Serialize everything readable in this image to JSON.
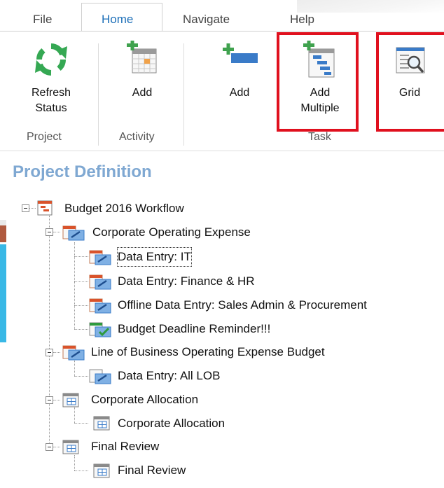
{
  "tabs": [
    {
      "label": "File",
      "active": false
    },
    {
      "label": "Home",
      "active": true
    },
    {
      "label": "Navigate",
      "active": false
    },
    {
      "label": "Help",
      "active": false
    }
  ],
  "ribbon": {
    "refresh_label_1": "Refresh",
    "refresh_label_2": "Status",
    "activity_add_label": "Add",
    "task_add_label": "Add",
    "add_multiple_1": "Add",
    "add_multiple_2": "Multiple",
    "grid_label": "Grid",
    "groups": {
      "project": "Project",
      "activity": "Activity",
      "task": "Task"
    }
  },
  "panel": {
    "title": "Project Definition"
  },
  "tree": {
    "root": "Budget 2016 Workflow",
    "corp_opex": "Corporate Operating Expense",
    "data_entry_it": "Data Entry: IT",
    "data_entry_finance": "Data Entry:  Finance & HR",
    "offline_entry": "Offline Data Entry:  Sales Admin & Procurement",
    "deadline": "Budget Deadline Reminder!!!",
    "lob_opex": "Line of Business Operating Expense Budget",
    "data_entry_lob": "Data Entry:  All LOB",
    "corp_alloc": "Corporate Allocation",
    "corp_alloc_child": "Corporate Allocation",
    "final_review": "Final Review",
    "final_review_child": "Final Review"
  },
  "colors": {
    "active_tab": "#1d6fb8",
    "highlight": "#e0101e",
    "panel_title": "#7fa8d2",
    "task_red": "#d9532b",
    "task_blue": "#3a7bc8",
    "check_green": "#2e9a3e"
  }
}
